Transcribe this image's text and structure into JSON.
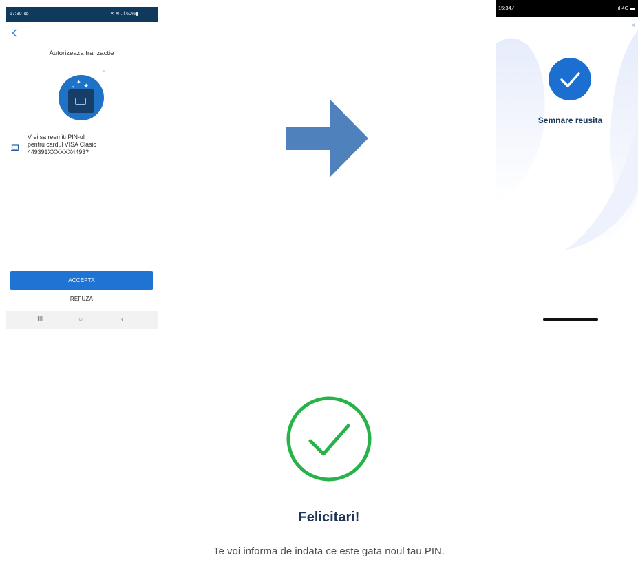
{
  "left_phone": {
    "status_time": "17:30",
    "status_time_icon": "ꝏ",
    "status_right": "✕ ≋ .ıl 60%▮",
    "title": "Autorizeaza tranzactie",
    "question_lines": [
      "Vrei sa reemiti PIN-ul",
      "pentru cardul VISA Clasic",
      "449391XXXXXX4493?"
    ],
    "accept_label": "ACCEPTA",
    "refuse_label": "REFUZA",
    "nav_recents": "III",
    "nav_home": "○",
    "nav_back": "‹"
  },
  "right_phone": {
    "status_time": "15:34 ⁄",
    "status_right": ".ıl 4G ▬",
    "close": "×",
    "success_text": "Semnare reusita"
  },
  "result": {
    "title": "Felicitari!",
    "message": "Te voi informa de indata ce este gata noul tau PIN."
  },
  "colors": {
    "primary_blue": "#1f73d2",
    "dark_status": "#0f3a5e",
    "arrow_blue": "#4f81bd",
    "success_green": "#27b24a",
    "success_badge_blue": "#1a6fd1"
  }
}
